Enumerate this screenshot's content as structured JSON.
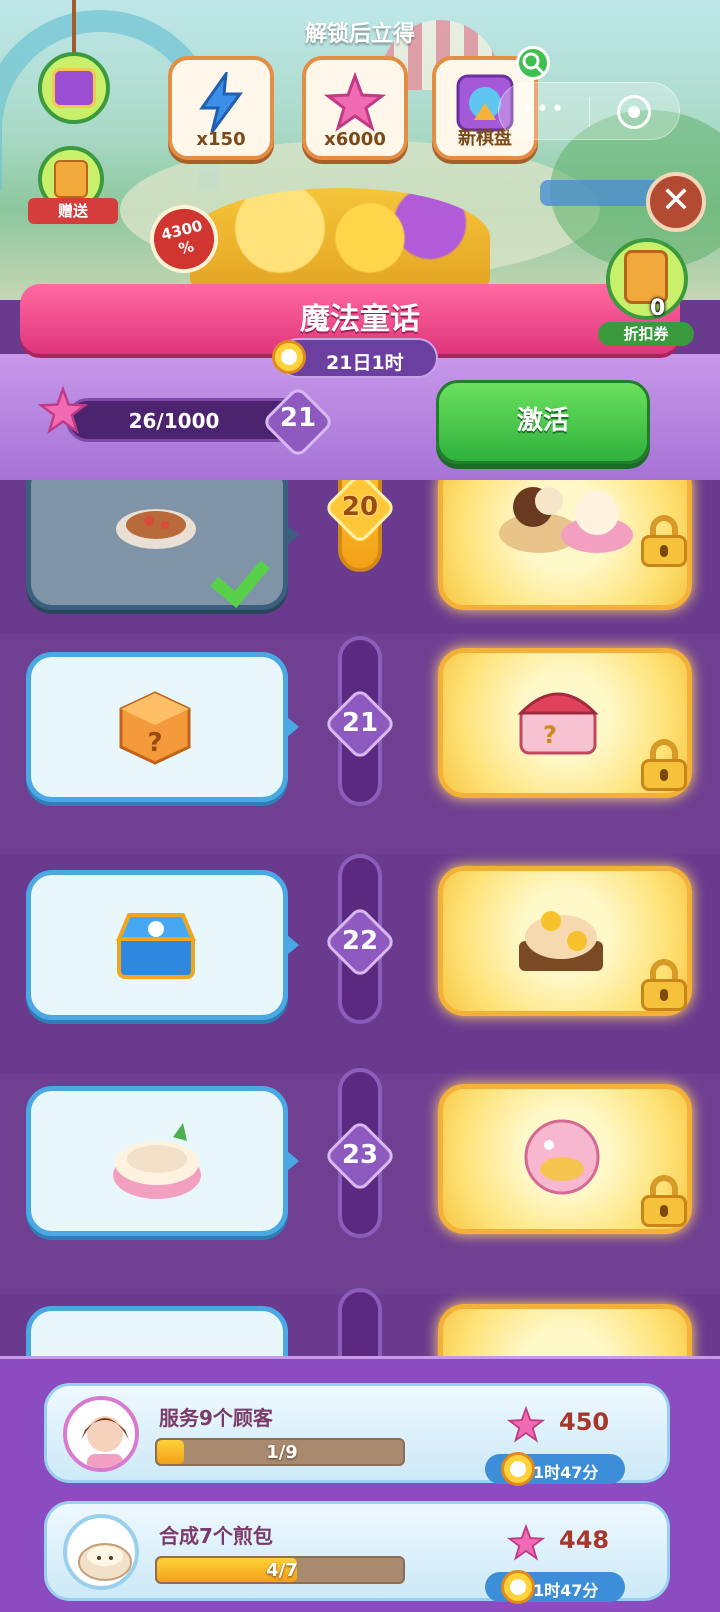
{
  "header": {
    "unlock_title": "解锁后立得",
    "rewards": [
      {
        "label": "x150",
        "icon": "energy-bolt-icon",
        "color": "#3d8ee8"
      },
      {
        "label": "x6000",
        "icon": "pink-star-icon",
        "color": "#f06bb3"
      },
      {
        "label": "新棋盘",
        "icon": "new-board-icon",
        "color": "#a45ad8"
      }
    ],
    "send_label": "赠送",
    "discount_percent": "4300",
    "discount_suffix": "%",
    "coupon_count": "0",
    "coupon_label": "折扣券"
  },
  "pass": {
    "title": "魔法童话",
    "time_remaining": "21日1时",
    "progress_text": "26/1000",
    "level": "21",
    "activate_label": "激活"
  },
  "levels": [
    {
      "number": "20",
      "free_item": "stuffed-pastry-icon",
      "free_claimed": true,
      "paid_item": "dessert-bowls-icon",
      "paid_locked": true
    },
    {
      "number": "21",
      "free_item": "mystery-cube-icon",
      "free_claimed": false,
      "paid_item": "mystery-chest-icon",
      "paid_locked": true
    },
    {
      "number": "22",
      "free_item": "blue-chest-icon",
      "free_claimed": false,
      "paid_item": "flower-cake-icon",
      "paid_locked": true
    },
    {
      "number": "23",
      "free_item": "noodle-bowl-icon",
      "free_claimed": false,
      "paid_item": "piggy-bank-icon",
      "paid_locked": true
    }
  ],
  "tasks": [
    {
      "name": "服务9个顾客",
      "progress": "1/9",
      "fraction": 0.111,
      "reward": "450",
      "time": "1时47分",
      "avatar": "girl-avatar-icon"
    },
    {
      "name": "合成7个煎包",
      "progress": "4/7",
      "fraction": 0.571,
      "reward": "448",
      "time": "1时47分",
      "avatar": "bun-avatar-icon"
    }
  ],
  "colors": {
    "accent_pink": "#e0357c",
    "activate_green": "#2fb13c",
    "panel_purple": "#6a3a8f"
  }
}
